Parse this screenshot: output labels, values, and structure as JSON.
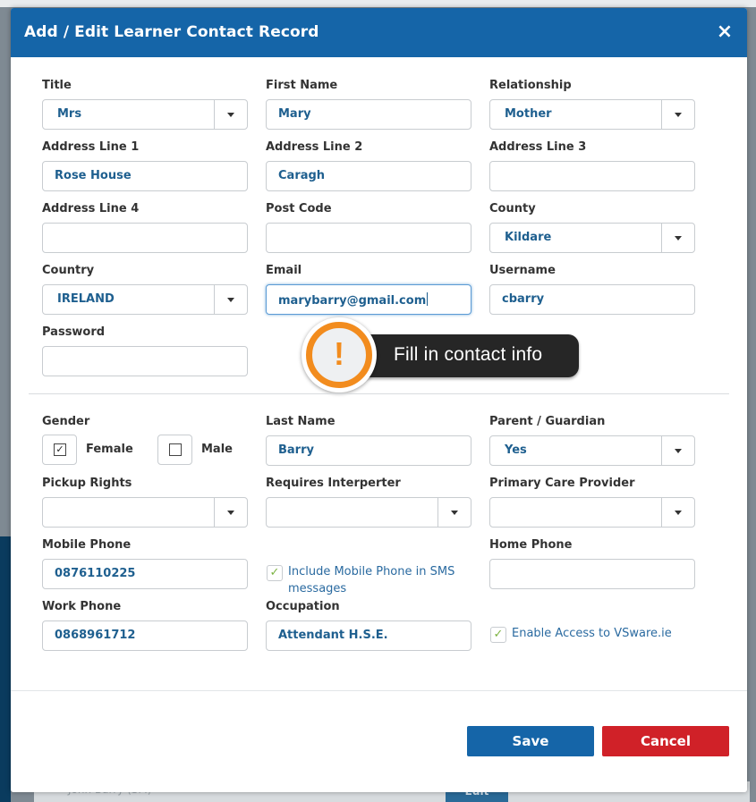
{
  "background": {
    "row_name": "John Barry (SM)",
    "row_button": "Edit"
  },
  "modal": {
    "title": "Add / Edit Learner Contact Record",
    "close_icon": "×"
  },
  "form": {
    "title": {
      "label": "Title",
      "value": "Mrs"
    },
    "first_name": {
      "label": "First Name",
      "value": "Mary"
    },
    "relationship": {
      "label": "Relationship",
      "value": "Mother"
    },
    "address1": {
      "label": "Address Line 1",
      "value": "Rose House"
    },
    "address2": {
      "label": "Address Line 2",
      "value": "Caragh"
    },
    "address3": {
      "label": "Address Line 3",
      "value": ""
    },
    "address4": {
      "label": "Address Line 4",
      "value": ""
    },
    "post_code": {
      "label": "Post Code",
      "value": ""
    },
    "county": {
      "label": "County",
      "value": "Kildare"
    },
    "country": {
      "label": "Country",
      "value": "IRELAND"
    },
    "email": {
      "label": "Email",
      "value": "marybarry@gmail.com"
    },
    "username": {
      "label": "Username",
      "value": "cbarry"
    },
    "password": {
      "label": "Password",
      "value": ""
    },
    "gender": {
      "label": "Gender",
      "female": "Female",
      "male": "Male",
      "female_checked": true,
      "male_checked": false
    },
    "last_name": {
      "label": "Last Name",
      "value": "Barry"
    },
    "parent_guardian": {
      "label": "Parent / Guardian",
      "value": "Yes"
    },
    "pickup_rights": {
      "label": "Pickup Rights",
      "value": ""
    },
    "requires_interpreter": {
      "label": "Requires Interperter",
      "value": ""
    },
    "primary_care": {
      "label": "Primary Care Provider",
      "value": ""
    },
    "mobile_phone": {
      "label": "Mobile Phone",
      "value": "0876110225"
    },
    "include_sms": {
      "label_line1": "Include Mobile Phone in SMS",
      "label_line2": "messages",
      "checked": true
    },
    "home_phone": {
      "label": "Home Phone",
      "value": ""
    },
    "work_phone": {
      "label": "Work Phone",
      "value": "0868961712"
    },
    "occupation": {
      "label": "Occupation",
      "value": "Attendant H.S.E."
    },
    "enable_access": {
      "label": "Enable Access to VSware.ie",
      "checked": true
    }
  },
  "callout": {
    "icon": "!",
    "text": "Fill in contact info"
  },
  "buttons": {
    "save": "Save",
    "cancel": "Cancel"
  },
  "colors": {
    "header": "#1565a8",
    "save": "#1565a8",
    "cancel": "#d02128",
    "callout_accent": "#f28c1e",
    "value_text": "#1e5f8f",
    "check": "#7cb342"
  }
}
